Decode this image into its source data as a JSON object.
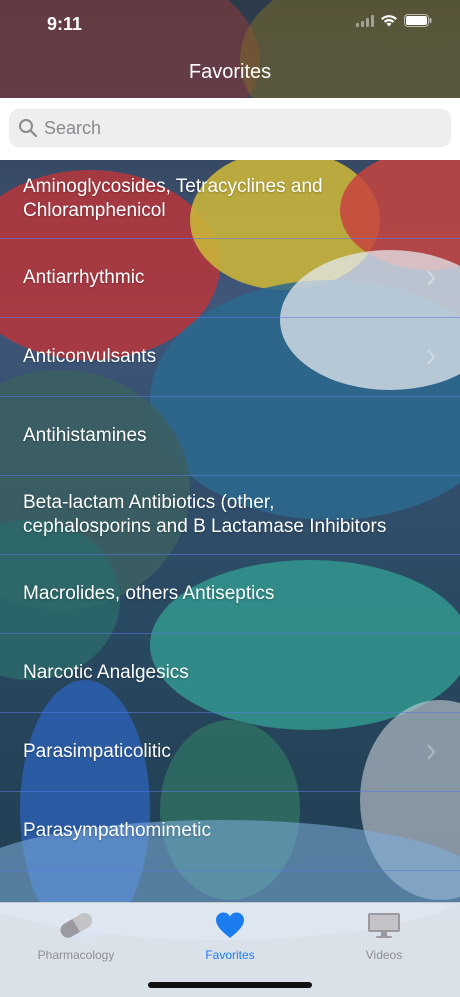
{
  "status_bar": {
    "time": "9:11"
  },
  "navbar": {
    "title": "Favorites"
  },
  "search": {
    "placeholder": "Search",
    "value": ""
  },
  "list": {
    "items": [
      {
        "label": "Aminoglycosides, Tetracyclines and Chloramphenicol",
        "chevron": false
      },
      {
        "label": "Antiarrhythmic",
        "chevron": true
      },
      {
        "label": "Anticonvulsants",
        "chevron": true
      },
      {
        "label": "Antihistamines",
        "chevron": false
      },
      {
        "label": "Beta-lactam Antibiotics (other, cephalosporins and B Lactamase Inhibitors",
        "chevron": false
      },
      {
        "label": "Macrolides, others Antiseptics",
        "chevron": false
      },
      {
        "label": "Narcotic Analgesics",
        "chevron": false
      },
      {
        "label": "Parasimpaticolitic",
        "chevron": true
      },
      {
        "label": "Parasympathomimetic",
        "chevron": false
      }
    ]
  },
  "tabbar": {
    "tabs": [
      {
        "label": "Pharmacology",
        "icon": "pill-icon",
        "active": false
      },
      {
        "label": "Favorites",
        "icon": "heart-icon",
        "active": true
      },
      {
        "label": "Videos",
        "icon": "monitor-icon",
        "active": false
      }
    ]
  },
  "colors": {
    "accent": "#1b7cf0",
    "divider": "#5a78e6",
    "inactive_tab": "#8e8e93"
  }
}
